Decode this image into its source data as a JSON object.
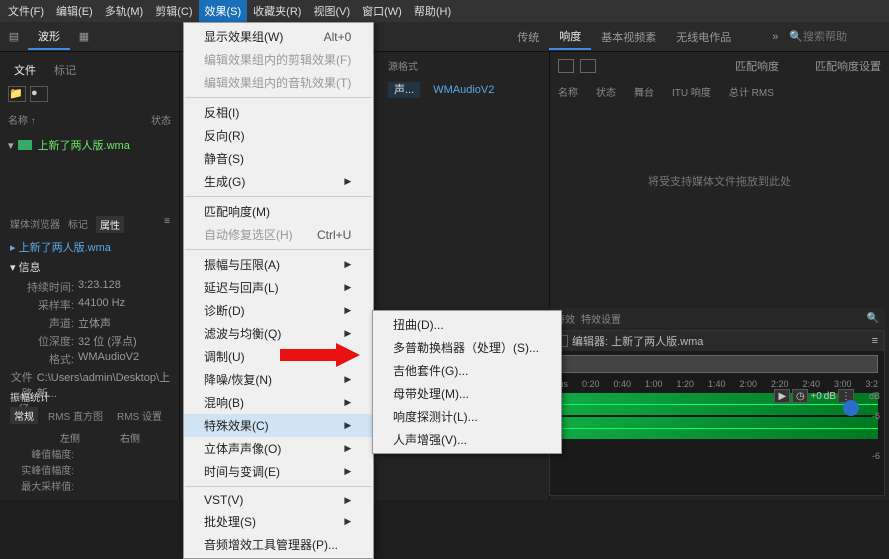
{
  "menubar": [
    "文件(F)",
    "编辑(E)",
    "多轨(M)",
    "剪辑(C)",
    "效果(S)",
    "收藏夹(R)",
    "视图(V)",
    "窗口(W)",
    "帮助(H)"
  ],
  "active_menu_index": 4,
  "top_tabs": [
    "波形",
    "传统",
    "响度",
    "基本视频素"
  ],
  "toolbar_pill": "无线电作品",
  "search_placeholder": "搜索帮助",
  "left_tabs": [
    "文件",
    "标记"
  ],
  "file_headers": [
    "名称 ↑",
    "状态"
  ],
  "file_name": "上新了两人版.wma",
  "format_label": "源格式",
  "format_value": "WMAudioV2",
  "media_tabs": [
    "媒体浏览器",
    "标记",
    "属性"
  ],
  "info_title": "信息",
  "info_file": "上新了两人版.wma",
  "info": {
    "持续时间": "3:23.128",
    "采样率": "44100 Hz",
    "声道": "立体声",
    "位深度": "32 位 (浮点)",
    "格式": "WMAudioV2",
    "文件路径": "C:\\Users\\admin\\Desktop\\上新..."
  },
  "stats_title": "振幅统计",
  "stats_tabs": [
    "常规",
    "RMS 直方图",
    "RMS 设置"
  ],
  "stat_cols": [
    "左侧",
    "右侧"
  ],
  "stat_rows": [
    "峰值幅度:",
    "实峰值幅度:",
    "最大采样值:"
  ],
  "right_panel_tab": "匹配响度",
  "right_setting": "匹配响度设置",
  "right_headers": [
    "名称",
    "状态",
    "舞台",
    "ITU 响度",
    "总计 RMS"
  ],
  "dropzone": "将受支持媒体文件拖放到此处",
  "menu_effects": [
    {
      "label": "显示效果组(W)",
      "shortcut": "Alt+0"
    },
    {
      "label": "编辑效果组内的剪辑效果(F)",
      "disabled": true
    },
    {
      "label": "编辑效果组内的音轨效果(T)",
      "disabled": true
    },
    {
      "sep": true
    },
    {
      "label": "反相(I)"
    },
    {
      "label": "反向(R)"
    },
    {
      "label": "静音(S)"
    },
    {
      "label": "生成(G)",
      "sub": true
    },
    {
      "sep": true
    },
    {
      "label": "匹配响度(M)"
    },
    {
      "label": "自动修复选区(H)",
      "shortcut": "Ctrl+U",
      "disabled": true
    },
    {
      "sep": true
    },
    {
      "label": "振幅与压限(A)",
      "sub": true
    },
    {
      "label": "延迟与回声(L)",
      "sub": true
    },
    {
      "label": "诊断(D)",
      "sub": true
    },
    {
      "label": "滤波与均衡(Q)",
      "sub": true
    },
    {
      "label": "调制(U)",
      "sub": true
    },
    {
      "label": "降噪/恢复(N)",
      "sub": true
    },
    {
      "label": "混响(B)",
      "sub": true
    },
    {
      "label": "特殊效果(C)",
      "sub": true,
      "hl": true
    },
    {
      "label": "立体声声像(O)",
      "sub": true
    },
    {
      "label": "时间与变调(E)",
      "sub": true
    },
    {
      "sep": true
    },
    {
      "label": "VST(V)",
      "sub": true
    },
    {
      "label": "批处理(S)",
      "sub": true
    },
    {
      "label": "音频增效工具管理器(P)..."
    }
  ],
  "submenu_special": [
    {
      "label": "扭曲(D)..."
    },
    {
      "label": "多普勒换档器（处理）(S)..."
    },
    {
      "label": "吉他套件(G)..."
    },
    {
      "label": "母带处理(M)..."
    },
    {
      "label": "响度探测计(L)..."
    },
    {
      "label": "人声增强(V)..."
    }
  ],
  "ruler": [
    "ms",
    "0:20",
    "0:40",
    "1:00",
    "1:20",
    "1:40",
    "2:00",
    "2:20",
    "2:40",
    "3:00",
    "3:2"
  ],
  "wave_title": "编辑器: 上新了两人版.wma",
  "db_controls": {
    "gain": "+0",
    "unit": "dB"
  },
  "small_tb": [
    "特效",
    "特效设置"
  ]
}
